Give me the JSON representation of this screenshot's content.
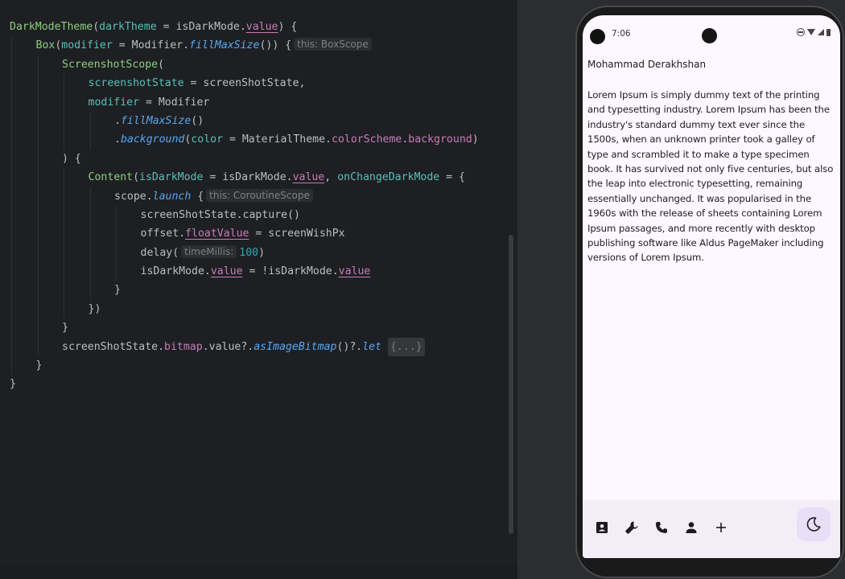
{
  "editor": {
    "lines": [
      {
        "indent": 0,
        "tokens": [
          {
            "t": "DarkModeTheme",
            "c": "comp"
          },
          {
            "t": "(",
            "c": "pl"
          },
          {
            "t": "darkTheme",
            "c": "named"
          },
          {
            "t": " = isDarkMode.",
            "c": "pl"
          },
          {
            "t": "value",
            "c": "prop"
          },
          {
            "t": ") {",
            "c": "pl"
          }
        ]
      },
      {
        "indent": 1,
        "tokens": [
          {
            "t": "Box",
            "c": "comp"
          },
          {
            "t": "(",
            "c": "pl"
          },
          {
            "t": "modifier",
            "c": "named"
          },
          {
            "t": " = Modifier.",
            "c": "pl"
          },
          {
            "t": "fillMaxSize",
            "c": "fn"
          },
          {
            "t": "()) {",
            "c": "pl"
          },
          {
            "hint": "this: BoxScope"
          }
        ]
      },
      {
        "indent": 2,
        "tokens": [
          {
            "t": "ScreenshotScope",
            "c": "comp"
          },
          {
            "t": "(",
            "c": "pl"
          }
        ]
      },
      {
        "indent": 3,
        "tokens": [
          {
            "t": "screenshotState",
            "c": "named"
          },
          {
            "t": " = screenShotState,",
            "c": "pl"
          }
        ]
      },
      {
        "indent": 3,
        "tokens": [
          {
            "t": "modifier",
            "c": "named"
          },
          {
            "t": " = Modifier",
            "c": "pl"
          }
        ]
      },
      {
        "indent": 4,
        "tokens": [
          {
            "t": ".",
            "c": "pl"
          },
          {
            "t": "fillMaxSize",
            "c": "fn"
          },
          {
            "t": "()",
            "c": "pl"
          }
        ]
      },
      {
        "indent": 4,
        "tokens": [
          {
            "t": ".",
            "c": "pl"
          },
          {
            "t": "background",
            "c": "fn"
          },
          {
            "t": "(",
            "c": "pl"
          },
          {
            "t": "color",
            "c": "named"
          },
          {
            "t": " = MaterialTheme.",
            "c": "pl"
          },
          {
            "t": "colorScheme",
            "c": "propi"
          },
          {
            "t": ".",
            "c": "pl"
          },
          {
            "t": "background",
            "c": "propi"
          },
          {
            "t": ")",
            "c": "pl"
          }
        ]
      },
      {
        "indent": 2,
        "tokens": [
          {
            "t": ") {",
            "c": "pl"
          }
        ]
      },
      {
        "indent": 3,
        "tokens": [
          {
            "t": "Content",
            "c": "comp"
          },
          {
            "t": "(",
            "c": "pl"
          },
          {
            "t": "isDarkMode",
            "c": "named"
          },
          {
            "t": " = isDarkMode.",
            "c": "pl"
          },
          {
            "t": "value",
            "c": "prop"
          },
          {
            "t": ", ",
            "c": "pl"
          },
          {
            "t": "onChangeDarkMode",
            "c": "named"
          },
          {
            "t": " = {",
            "c": "pl"
          }
        ]
      },
      {
        "indent": 4,
        "tokens": [
          {
            "t": "scope.",
            "c": "pl"
          },
          {
            "t": "launch",
            "c": "fn"
          },
          {
            "t": " {",
            "c": "pl"
          },
          {
            "hint": "this: CoroutineScope"
          }
        ]
      },
      {
        "indent": 5,
        "tokens": [
          {
            "t": "screenShotState.capture()",
            "c": "pl"
          }
        ]
      },
      {
        "indent": 5,
        "tokens": [
          {
            "t": "offset.",
            "c": "pl"
          },
          {
            "t": "floatValue",
            "c": "prop"
          },
          {
            "t": " = screenWishPx",
            "c": "pl"
          }
        ]
      },
      {
        "indent": 5,
        "tokens": [
          {
            "t": "delay(",
            "c": "pl"
          },
          {
            "hint": "timeMillis:"
          },
          {
            "t": "100",
            "c": "num"
          },
          {
            "t": ")",
            "c": "pl"
          }
        ]
      },
      {
        "indent": 5,
        "tokens": [
          {
            "t": "isDarkMode.",
            "c": "pl"
          },
          {
            "t": "value",
            "c": "prop"
          },
          {
            "t": " = !isDarkMode.",
            "c": "pl"
          },
          {
            "t": "value",
            "c": "prop"
          }
        ]
      },
      {
        "indent": 4,
        "tokens": [
          {
            "t": "}",
            "c": "pl"
          }
        ]
      },
      {
        "indent": 3,
        "tokens": [
          {
            "t": "})",
            "c": "pl"
          }
        ]
      },
      {
        "indent": 2,
        "tokens": [
          {
            "t": "}",
            "c": "pl"
          }
        ]
      },
      {
        "indent": 2,
        "tokens": [
          {
            "t": "screenShotState.",
            "c": "pl"
          },
          {
            "t": "bitmap",
            "c": "propi"
          },
          {
            "t": ".value?.",
            "c": "pl"
          },
          {
            "t": "asImageBitmap",
            "c": "fn"
          },
          {
            "t": "()?.",
            "c": "pl"
          },
          {
            "t": "let",
            "c": "fn"
          },
          {
            "t": " ",
            "c": "pl"
          },
          {
            "fold": "{...}"
          }
        ]
      },
      {
        "indent": 1,
        "tokens": [
          {
            "t": "}",
            "c": "pl"
          }
        ]
      },
      {
        "indent": 0,
        "tokens": [
          {
            "t": "}",
            "c": "pl"
          }
        ]
      }
    ]
  },
  "phone": {
    "status": {
      "time": "7:06"
    },
    "name": "Mohammad Derakhshan",
    "body": "Lorem Ipsum is simply dummy text of the printing and typesetting industry. Lorem Ipsum has been the industry's standard dummy text ever since the 1500s, when an unknown printer took a galley of type and scrambled it to make a type specimen book. It has survived not only five centuries, but also the leap into electronic typesetting, remaining essentially unchanged. It was popularised in the 1960s with the release of sheets containing Lorem Ipsum passages, and more recently with desktop publishing software like Aldus PageMaker including versions of Lorem Ipsum.",
    "bottom_icons": [
      "contact-card-icon",
      "wrench-icon",
      "phone-icon",
      "person-icon",
      "plus-icon"
    ],
    "fab_icon": "moon-icon"
  },
  "colors": {
    "editor_bg": "#1e1f22",
    "composable": "#8ccf7e",
    "named_arg": "#56c1b8",
    "property": "#c77dbb",
    "function": "#56a8f5",
    "number": "#2aacb8",
    "phone_bg": "#fdf7ff",
    "bottom_bar": "#f3edf7",
    "fab": "#e8def8"
  }
}
